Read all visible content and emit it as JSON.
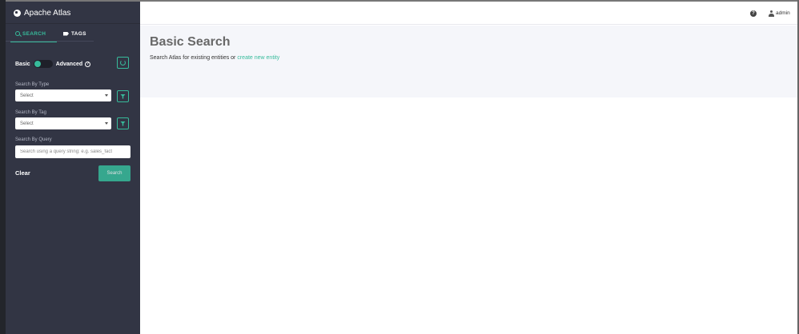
{
  "app": {
    "title": "Apache Atlas"
  },
  "tabs": {
    "search": "SEARCH",
    "tags": "TAGS"
  },
  "mode": {
    "basic": "Basic",
    "advanced": "Advanced"
  },
  "filters": {
    "type_label": "Search By Type",
    "type_value": "Select",
    "tag_label": "Search By Tag",
    "tag_value": "Select",
    "query_label": "Search By Query",
    "query_placeholder": "Search using a query string: e.g. sales_fact"
  },
  "actions": {
    "clear": "Clear",
    "search": "Search"
  },
  "header": {
    "user": "admin"
  },
  "main": {
    "title": "Basic Search",
    "subtitle": "Search Atlas for existing entities or ",
    "subtitle_link": "create new entity"
  },
  "colors": {
    "accent": "#37bb9b",
    "sidebar": "#323544",
    "hero_bg": "#f5f6fa"
  },
  "icons": [
    "globe-icon",
    "search-icon",
    "tag-icon",
    "help-icon",
    "refresh-icon",
    "filter-icon",
    "user-icon"
  ]
}
